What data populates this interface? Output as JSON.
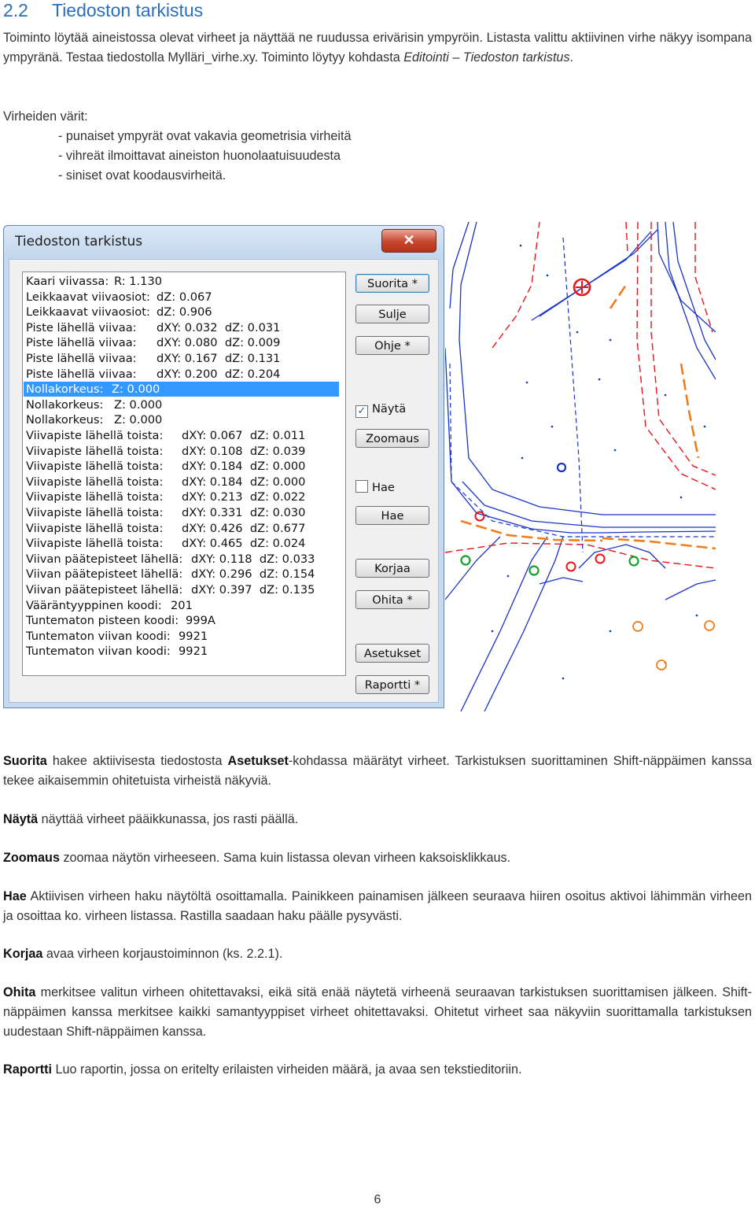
{
  "heading": {
    "number": "2.2",
    "title": "Tiedoston tarkistus"
  },
  "intro": {
    "line1": "Toiminto löytää aineistossa olevat virheet ja näyttää ne ruudussa erivärisin ympyröin. Listasta valittu aktiivinen virhe näkyy isompana ympyränä. Testaa tiedostolla Mylläri_virhe.xy. Toiminto löytyy kohdasta ",
    "menu_path": "Editointi – Tiedoston tarkistus",
    "end": "."
  },
  "colors_section": {
    "label": "Virheiden värit:",
    "items": [
      "- punaiset ympyrät ovat vakavia geometrisia virheitä",
      "- vihreät ilmoittavat aineiston huonolaatuisuudesta",
      "- siniset ovat koodausvirheitä."
    ]
  },
  "dialog": {
    "title": "Tiedoston tarkistus",
    "close_glyph": "✕",
    "list": [
      {
        "label": "Kaari viivassa:",
        "value": "R: 1.130"
      },
      {
        "label": "Leikkaavat viivaosiot:",
        "value": "dZ: 0.067"
      },
      {
        "label": "Leikkaavat viivaosiot:",
        "value": "dZ: 0.906"
      },
      {
        "label": "Piste lähellä viivaa:",
        "value": "dXY: 0.032  dZ: 0.031"
      },
      {
        "label": "Piste lähellä viivaa:",
        "value": "dXY: 0.080  dZ: 0.009"
      },
      {
        "label": "Piste lähellä viivaa:",
        "value": "dXY: 0.167  dZ: 0.131"
      },
      {
        "label": "Piste lähellä viivaa:",
        "value": "dXY: 0.200  dZ: 0.204"
      },
      {
        "label": "Nollakorkeus:",
        "value": "Z: 0.000",
        "selected": true
      },
      {
        "label": "Nollakorkeus:",
        "value": "Z: 0.000"
      },
      {
        "label": "Nollakorkeus:",
        "value": "Z: 0.000"
      },
      {
        "label": "Viivapiste lähellä toista:",
        "value": "dXY: 0.067  dZ: 0.011"
      },
      {
        "label": "Viivapiste lähellä toista:",
        "value": "dXY: 0.108  dZ: 0.039"
      },
      {
        "label": "Viivapiste lähellä toista:",
        "value": "dXY: 0.184  dZ: 0.000"
      },
      {
        "label": "Viivapiste lähellä toista:",
        "value": "dXY: 0.184  dZ: 0.000"
      },
      {
        "label": "Viivapiste lähellä toista:",
        "value": "dXY: 0.213  dZ: 0.022"
      },
      {
        "label": "Viivapiste lähellä toista:",
        "value": "dXY: 0.331  dZ: 0.030"
      },
      {
        "label": "Viivapiste lähellä toista:",
        "value": "dXY: 0.426  dZ: 0.677"
      },
      {
        "label": "Viivapiste lähellä toista:",
        "value": "dXY: 0.465  dZ: 0.024"
      },
      {
        "label": "Viivan päätepisteet lähellä:",
        "value": "dXY: 0.118  dZ: 0.033"
      },
      {
        "label": "Viivan päätepisteet lähellä:",
        "value": "dXY: 0.296  dZ: 0.154"
      },
      {
        "label": "Viivan päätepisteet lähellä:",
        "value": "dXY: 0.397  dZ: 0.135"
      },
      {
        "label": "Vääräntyyppinen koodi:",
        "value": "201"
      },
      {
        "label": "Tuntematon pisteen koodi:",
        "value": "999A"
      },
      {
        "label": "Tuntematon viivan koodi:",
        "value": "9921"
      },
      {
        "label": "Tuntematon viivan koodi:",
        "value": "9921"
      }
    ],
    "buttons": {
      "suorita": "Suorita *",
      "sulje": "Sulje",
      "ohje": "Ohje *",
      "zoomaus": "Zoomaus",
      "hae": "Hae",
      "korjaa": "Korjaa",
      "ohita": "Ohita *",
      "asetukset": "Asetukset",
      "raportti": "Raportti *"
    },
    "checkboxes": {
      "nayta": {
        "label": "Näytä",
        "checked": true,
        "mark": "✓"
      },
      "hae": {
        "label": "Hae",
        "checked": false
      }
    }
  },
  "map_colors": {
    "red": "#e8141a",
    "green": "#12a02a",
    "blue": "#1634c8",
    "orange": "#f07d1a"
  },
  "descriptions": {
    "suorita": {
      "term": "Suorita",
      "t1": " hakee aktiivisesta tiedostosta ",
      "term2": "Asetukset",
      "t2": "-kohdassa määrätyt virheet. Tarkistuksen suorittaminen Shift-näppäimen kanssa tekee aikaisemmin ohitetuista virheistä näkyviä."
    },
    "nayta": {
      "term": "Näytä",
      "text": " näyttää virheet pääikkunassa, jos rasti päällä."
    },
    "zoomaus": {
      "term": "Zoomaus",
      "text": " zoomaa näytön virheeseen. Sama kuin listassa olevan virheen kaksoisklikkaus."
    },
    "hae": {
      "term": "Hae",
      "text": " Aktiivisen virheen haku näytöltä osoittamalla. Painikkeen painamisen jälkeen seuraava hiiren osoitus aktivoi lähimmän virheen ja osoittaa ko. virheen listassa. Rastilla saadaan haku päälle pysyvästi."
    },
    "korjaa": {
      "term": "Korjaa",
      "text": " avaa virheen korjaustoiminnon (ks. 2.2.1)."
    },
    "ohita": {
      "term": "Ohita",
      "text": " merkitsee valitun virheen ohitettavaksi, eikä sitä enää näytetä virheenä seuraavan tarkistuksen suorittamisen jälkeen. Shift-näppäimen kanssa merkitsee kaikki samantyyppiset virheet ohitettavaksi. Ohitetut virheet saa näkyviin suorittamalla tarkistuksen uudestaan Shift-näppäimen kanssa."
    },
    "raportti": {
      "term": "Raportti",
      "text": "  Luo raportin, jossa on eritelty erilaisten virheiden määrä, ja avaa sen tekstieditoriin."
    }
  },
  "page_number": "6"
}
